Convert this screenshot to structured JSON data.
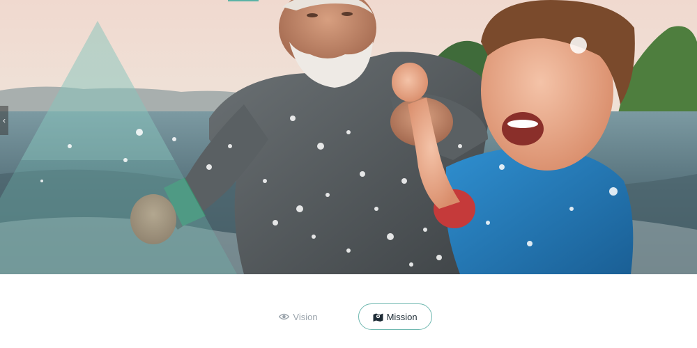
{
  "hero": {
    "photo": "grandfather-and-child-splashing-in-sea"
  },
  "slider": {
    "prev_icon": "chevron-left-icon",
    "prev_glyph": "‹"
  },
  "tabs": [
    {
      "label": "Vision",
      "icon": "eye-icon",
      "active": false
    },
    {
      "label": "Mission",
      "icon": "map-marker-icon",
      "active": true
    }
  ],
  "colors": {
    "accent": "#6fb8b0",
    "inactive_text": "#9aa3ab",
    "active_text": "#1d2b35"
  }
}
